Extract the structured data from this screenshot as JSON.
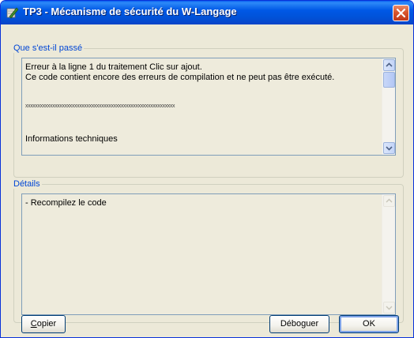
{
  "window": {
    "title": "TP3 - Mécanisme de sécurité du W-Langage"
  },
  "group_what": {
    "legend": "Que s'est-il passé",
    "lines": [
      "Erreur à la ligne 1 du traitement Clic sur ajout.",
      "Ce code contient encore des erreurs de compilation et ne peut pas être exécuté.",
      "xxxxxxxxxxxxxxxxxxxxxxxxxxxxxxxxxxxxxxxxxxxxxxxxxxxxxxxxxxxxx",
      "Informations techniques"
    ]
  },
  "group_details": {
    "legend": "Détails",
    "lines": [
      "- Recompilez le code"
    ]
  },
  "buttons": {
    "copy_first": "C",
    "copy_rest": "opier",
    "debug": "Déboguer",
    "ok": "OK"
  },
  "icons": {
    "app": "windev-app-icon",
    "close": "close-icon",
    "scroll_up": "scroll-up-arrow-icon",
    "scroll_down": "scroll-down-arrow-icon"
  },
  "colors": {
    "titlebar": "#0058e6",
    "legend": "#0046d5",
    "close_button": "#d9562d"
  }
}
